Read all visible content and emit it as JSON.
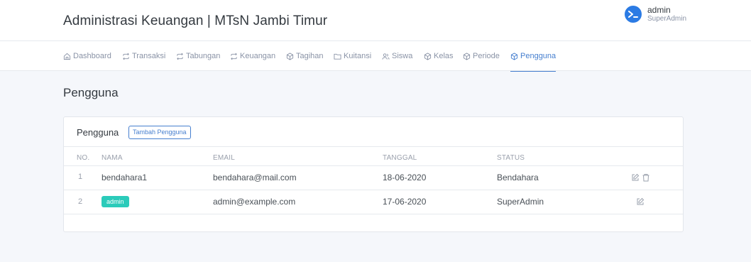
{
  "header": {
    "title": "Administrasi Keuangan | MTsN Jambi Timur",
    "user_name": "admin",
    "user_role": "SuperAdmin"
  },
  "nav": {
    "items": [
      {
        "label": "Dashboard",
        "icon": "home-icon"
      },
      {
        "label": "Transaksi",
        "icon": "repeat-icon"
      },
      {
        "label": "Tabungan",
        "icon": "repeat-icon"
      },
      {
        "label": "Keuangan",
        "icon": "repeat-icon"
      },
      {
        "label": "Tagihan",
        "icon": "box-icon"
      },
      {
        "label": "Kuitansi",
        "icon": "folder-icon"
      },
      {
        "label": "Siswa",
        "icon": "users-icon"
      },
      {
        "label": "Kelas",
        "icon": "box-icon"
      },
      {
        "label": "Periode",
        "icon": "box-icon"
      },
      {
        "label": "Pengguna",
        "icon": "box-icon"
      }
    ],
    "active": "Pengguna"
  },
  "page": {
    "title": "Pengguna"
  },
  "card": {
    "title": "Pengguna",
    "add_button": "Tambah Pengguna"
  },
  "table": {
    "columns": [
      "NO.",
      "NAMA",
      "EMAIL",
      "TANGGAL",
      "STATUS"
    ],
    "rows": [
      {
        "no": "1",
        "name": "bendahara1",
        "email": "bendahara@mail.com",
        "date": "18-06-2020",
        "status": "Bendahara",
        "actions": [
          "edit-icon",
          "trash-icon"
        ]
      },
      {
        "no": "2",
        "name": "admin",
        "email": "admin@example.com",
        "date": "17-06-2020",
        "status": "SuperAdmin",
        "actions": [
          "edit-icon"
        ]
      }
    ]
  },
  "colors": {
    "accent": "#467fcf",
    "badge": "#2bcbba",
    "avatar": "#2b7be4"
  }
}
